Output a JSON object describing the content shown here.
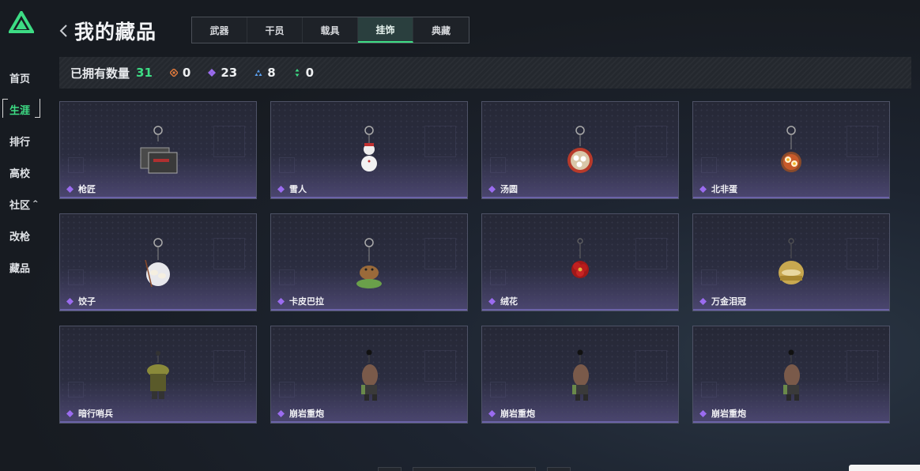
{
  "sidebar": {
    "logo_icon": "triangle-logo-icon",
    "items": [
      {
        "label": "首页",
        "active": false
      },
      {
        "label": "生涯",
        "active": true
      },
      {
        "label": "排行",
        "active": false
      },
      {
        "label": "高校",
        "active": false
      },
      {
        "label": "社区",
        "active": false,
        "caret": "^"
      },
      {
        "label": "改枪",
        "active": false
      },
      {
        "label": "藏品",
        "active": false
      }
    ]
  },
  "header": {
    "back_icon": "chevron-left-icon",
    "title": "我的藏品"
  },
  "tabs": [
    {
      "label": "武器",
      "active": false
    },
    {
      "label": "干员",
      "active": false
    },
    {
      "label": "载具",
      "active": false
    },
    {
      "label": "挂饰",
      "active": true
    },
    {
      "label": "典藏",
      "active": false
    }
  ],
  "stats": {
    "label": "已拥有数量",
    "total": "31",
    "counts": [
      {
        "icon": "orange-diamond-icon",
        "color": "#e07a3c",
        "value": "0"
      },
      {
        "icon": "purple-diamond-icon",
        "color": "#9b6cf0",
        "value": "23"
      },
      {
        "icon": "blue-triangle-icon",
        "color": "#5aa0f0",
        "value": "8"
      },
      {
        "icon": "green-arrows-icon",
        "color": "#3ddc84",
        "value": "0"
      }
    ]
  },
  "colors": {
    "accent": "#3ddc84",
    "rarity_purple": "#9b6cf0"
  },
  "items": [
    {
      "name": "枪匠",
      "art": "toolbox-charm"
    },
    {
      "name": "雪人",
      "art": "snowman-charm"
    },
    {
      "name": "汤圆",
      "art": "bowl-charm"
    },
    {
      "name": "北非蛋",
      "art": "pan-charm"
    },
    {
      "name": "饺子",
      "art": "dumpling-charm"
    },
    {
      "name": "卡皮巴拉",
      "art": "capybara-charm"
    },
    {
      "name": "绒花",
      "art": "flower-charm"
    },
    {
      "name": "万金泪冠",
      "art": "crown-charm"
    },
    {
      "name": "暗行哨兵",
      "art": "sentinel-charm"
    },
    {
      "name": "崩岩重炮",
      "art": "figure-charm"
    },
    {
      "name": "崩岩重炮",
      "art": "figure-charm"
    },
    {
      "name": "崩岩重炮",
      "art": "figure-charm"
    }
  ]
}
